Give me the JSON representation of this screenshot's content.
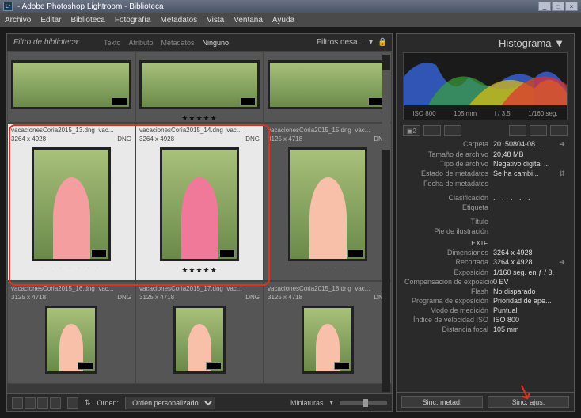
{
  "window": {
    "title": "- Adobe Photoshop Lightroom - Biblioteca",
    "logo": "Lr"
  },
  "menubar": [
    "Archivo",
    "Editar",
    "Biblioteca",
    "Fotografía",
    "Metadatos",
    "Vista",
    "Ventana",
    "Ayuda"
  ],
  "filter": {
    "label": "Filtro de biblioteca:",
    "tabs": [
      "Texto",
      "Atributo",
      "Metadatos",
      "Ninguno"
    ],
    "active": 3,
    "dropdown": "Filtros desa..."
  },
  "thumbs": [
    {
      "name": "",
      "dims": "",
      "fmt": "",
      "stars": 0,
      "sel": false,
      "top": true
    },
    {
      "name": "",
      "dims": "",
      "fmt": "",
      "stars": 5,
      "sel": false,
      "top": true
    },
    {
      "name": "",
      "dims": "",
      "fmt": "",
      "stars": 0,
      "sel": false,
      "top": true
    },
    {
      "name": "vacacionesCoria2015_13.dng",
      "short": "vac...",
      "dims": "3264 x 4928",
      "fmt": "DNG",
      "stars": 0,
      "sel": true
    },
    {
      "name": "vacacionesCoria2015_14.dng",
      "short": "vac...",
      "dims": "3264 x 4928",
      "fmt": "DNG",
      "stars": 5,
      "sel": true
    },
    {
      "name": "vacacionesCoria2015_15.dng",
      "short": "vac...",
      "dims": "3125 x 4718",
      "fmt": "DNG",
      "stars": 0,
      "sel": false
    },
    {
      "name": "vacacionesCoria2015_16.dng",
      "short": "vac...",
      "dims": "3125 x 4718",
      "fmt": "DNG",
      "stars": 0,
      "sel": false
    },
    {
      "name": "vacacionesCoria2015_17.dng",
      "short": "vac...",
      "dims": "3125 x 4718",
      "fmt": "DNG",
      "stars": 0,
      "sel": false
    },
    {
      "name": "vacacionesCoria2015_18.dng",
      "short": "vac...",
      "dims": "3125 x 4718",
      "fmt": "DNG",
      "stars": 0,
      "sel": false
    }
  ],
  "bottombar": {
    "sort_label": "Orden:",
    "sort_value": "Orden personalizado",
    "thumb_label": "Miniaturas"
  },
  "histogram": {
    "title": "Histograma",
    "iso": "ISO 800",
    "focal": "105 mm",
    "aperture": "f / 3,5",
    "shutter": "1/160 seg.",
    "selcount": "2"
  },
  "meta": {
    "carpeta_k": "Carpeta",
    "carpeta_v": "20150804-08...",
    "tamano_k": "Tamaño de archivo",
    "tamano_v": "20,48 MB",
    "tipo_k": "Tipo de archivo",
    "tipo_v": "Negativo digital ...",
    "estado_k": "Estado de metadatos",
    "estado_v": "Se ha cambi...",
    "fecha_k": "Fecha de metadatos",
    "fecha_v": "",
    "clasif_k": "Clasificación",
    "clasif_v": ". . . . .",
    "etiq_k": "Etiqueta",
    "etiq_v": "",
    "titulo_k": "Título",
    "titulo_v": "",
    "pie_k": "Pie de ilustración",
    "pie_v": "",
    "exif": "EXIF",
    "dim_k": "Dimensiones",
    "dim_v": "3264 x 4928",
    "rec_k": "Recortada",
    "rec_v": "3264 x 4928",
    "exp_k": "Exposición",
    "exp_v": "1/160 seg. en ƒ / 3,",
    "comp_k": "Compensación de exposición",
    "comp_v": "0 EV",
    "flash_k": "Flash",
    "flash_v": "No disparado",
    "prog_k": "Programa de exposición",
    "prog_v": "Prioridad de ape...",
    "med_k": "Modo de medición",
    "med_v": "Puntual",
    "isospd_k": "Índice de velocidad ISO",
    "isospd_v": "ISO 800",
    "dist_k": "Distancia focal",
    "dist_v": "105 mm"
  },
  "sync": {
    "metad": "Sinc. metad.",
    "ajus": "Sinc. ajus."
  }
}
